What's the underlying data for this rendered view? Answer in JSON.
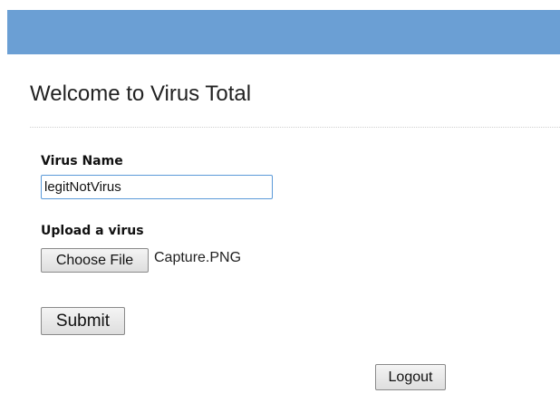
{
  "header": {
    "bar_color": "#6b9fd4"
  },
  "page": {
    "title": "Welcome to Virus Total"
  },
  "form": {
    "virus_name_label": "Virus Name",
    "virus_name_value": "legitNotVirus",
    "upload_label": "Upload a virus",
    "choose_file_label": "Choose File",
    "selected_file": "Capture.PNG",
    "submit_label": "Submit"
  },
  "footer": {
    "logout_label": "Logout"
  }
}
